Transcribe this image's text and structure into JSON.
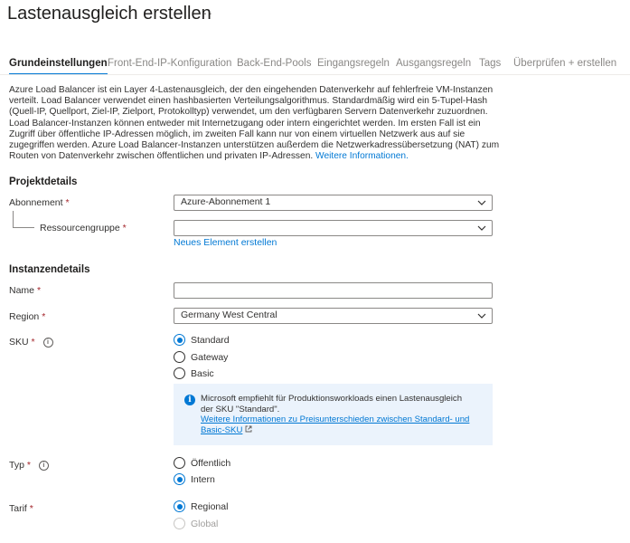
{
  "page": {
    "title": "Lastenausgleich erstellen",
    "more": "···"
  },
  "tabs": [
    {
      "label": "Grundeinstellungen",
      "active": true
    },
    {
      "label": "Front-End-IP-Konfiguration"
    },
    {
      "label": "Back-End-Pools"
    },
    {
      "label": "Eingangsregeln"
    },
    {
      "label": "Ausgangsregeln"
    },
    {
      "label": "Tags"
    },
    {
      "label": "Überprüfen + erstellen"
    }
  ],
  "description": {
    "text": "Azure Load Balancer ist ein Layer 4-Lastenausgleich, der den eingehenden Datenverkehr auf fehlerfreie VM-Instanzen verteilt. Load Balancer verwendet einen hashbasierten Verteilungsalgorithmus. Standardmäßig wird ein 5-Tupel-Hash (Quell-IP, Quellport, Ziel-IP, Zielport, Protokolltyp) verwendet, um den verfügbaren Servern Datenverkehr zuzuordnen. Load Balancer-Instanzen können entweder mit Internetzugang oder intern eingerichtet werden. Im ersten Fall ist ein Zugriff über öffentliche IP-Adressen möglich, im zweiten Fall kann nur von einem virtuellen Netzwerk aus auf sie zugegriffen werden. Azure Load Balancer-Instanzen unterstützen außerdem die Netzwerkadressübersetzung (NAT) zum Routen von Datenverkehr zwischen öffentlichen und privaten IP-Adressen.",
    "link": "Weitere Informationen."
  },
  "project": {
    "heading": "Projektdetails",
    "subscription_label": "Abonnement",
    "subscription_value": "Azure-Abonnement 1",
    "resource_group_label": "Ressourcengruppe",
    "resource_group_value": "",
    "create_new_link": "Neues Element erstellen"
  },
  "instance": {
    "heading": "Instanzendetails",
    "name_label": "Name",
    "name_value": "",
    "region_label": "Region",
    "region_value": "Germany West Central",
    "sku_label": "SKU",
    "sku_options": [
      "Standard",
      "Gateway",
      "Basic"
    ],
    "sku_selected": "Standard",
    "sku_info_text": "Microsoft empfiehlt für Produktionsworkloads einen Lastenausgleich der SKU \"Standard\".",
    "sku_info_link": "Weitere Informationen zu Preisunterschieden zwischen Standard- und Basic-SKU",
    "type_label": "Typ",
    "type_options": [
      "Öffentlich",
      "Intern"
    ],
    "type_selected": "Intern",
    "tier_label": "Tarif",
    "tier_options": [
      "Regional",
      "Global"
    ],
    "tier_selected": "Regional"
  },
  "common": {
    "required_mark": "*",
    "info_glyph": "i"
  },
  "colors": {
    "accent": "#0078d4",
    "required": "#a4262c",
    "info_bg": "#ebf3fc"
  }
}
